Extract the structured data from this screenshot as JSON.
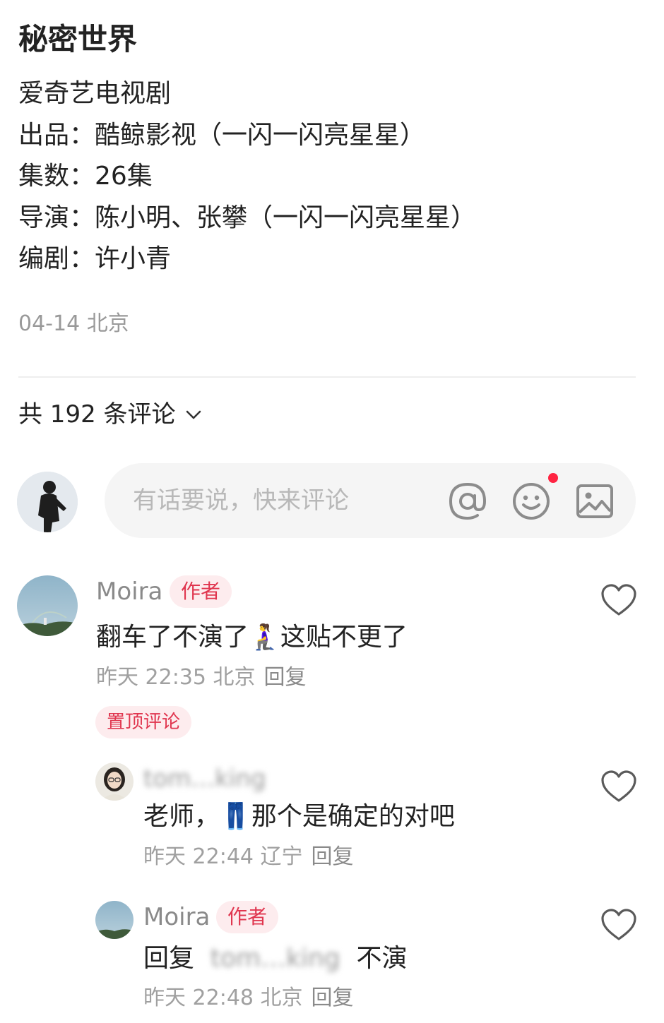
{
  "post": {
    "title": "秘密世界",
    "lines": [
      "爱奇艺电视剧",
      "出品：酷鲸影视（一闪一闪亮星星）",
      "集数：26集",
      "导演：陈小明、张攀（一闪一闪亮星星）",
      "编剧：许小青"
    ],
    "meta": "04-14 北京"
  },
  "comments_header": {
    "count_text": "共 192 条评论",
    "chevron_icon": "chevron-down-icon"
  },
  "comment_input": {
    "placeholder": "有话要说，快来评论",
    "icons": [
      "at-icon",
      "emoji-icon",
      "image-icon"
    ],
    "notification_color": "#ff2442"
  },
  "comments": [
    {
      "username": "Moira",
      "badge": "作者",
      "text_before_emoji": "翻车了不演了",
      "emoji": "🧎‍♀️",
      "text_after_emoji": "这贴不更了",
      "time": "昨天 22:35 北京",
      "reply": "回复",
      "pinned_label": "置顶评论"
    },
    {
      "username": "tom…king",
      "text_before_emoji": "老师，",
      "emoji": "👖",
      "text_after_emoji": "那个是确定的对吧",
      "time": "昨天 22:44 辽宁",
      "reply": "回复"
    },
    {
      "username": "Moira",
      "badge": "作者",
      "text_prefix": "回复",
      "mention": "tom…king",
      "text_suffix": "不演",
      "time": "昨天 22:48 北京",
      "reply": "回复"
    }
  ],
  "colors": {
    "accent_red": "#e0364f",
    "badge_bg": "#fdecee",
    "muted_text": "#999999"
  }
}
